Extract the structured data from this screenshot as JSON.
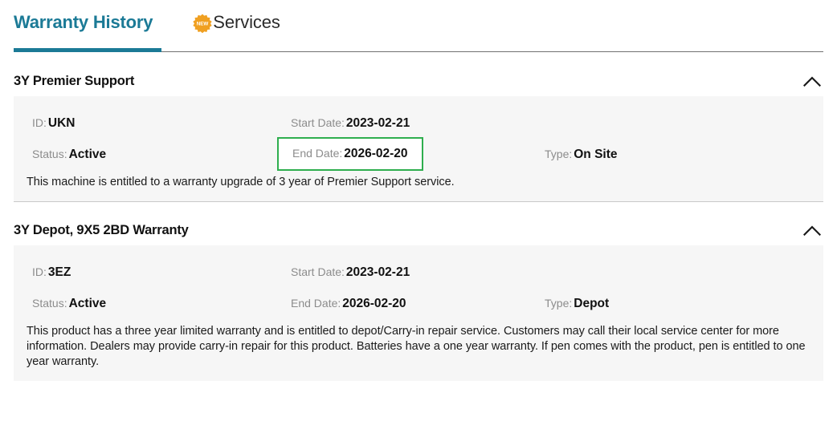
{
  "tabs": [
    {
      "id": "warranty-history",
      "label": "Warranty History",
      "active": true,
      "badge": null
    },
    {
      "id": "services",
      "label": "Services",
      "active": false,
      "badge": "NEW"
    }
  ],
  "colors": {
    "accent_teal": "#1b7a96",
    "badge_orange": "#f0a021",
    "highlight_green": "#2eae4e",
    "panel_bg": "#f6f6f6",
    "label_gray": "#8c8c8c"
  },
  "sections": [
    {
      "title": "3Y Premier Support",
      "expanded": true,
      "toggle_icon": "chevron-up-icon",
      "fields": {
        "id_label": "ID:",
        "id_value": "UKN",
        "start_date_label": "Start Date:",
        "start_date_value": "2023-02-21",
        "status_label": "Status:",
        "status_value": "Active",
        "end_date_label": "End Date:",
        "end_date_value": "2026-02-20",
        "type_label": "Type:",
        "type_value": "On Site"
      },
      "highlighted_field": "end_date",
      "description": "This machine is entitled to a warranty upgrade of 3 year of Premier Support service."
    },
    {
      "title": "3Y Depot, 9X5 2BD Warranty",
      "expanded": true,
      "toggle_icon": "chevron-up-icon",
      "fields": {
        "id_label": "ID:",
        "id_value": "3EZ",
        "start_date_label": "Start Date:",
        "start_date_value": "2023-02-21",
        "status_label": "Status:",
        "status_value": "Active",
        "end_date_label": "End Date:",
        "end_date_value": "2026-02-20",
        "type_label": "Type:",
        "type_value": "Depot"
      },
      "highlighted_field": null,
      "description": "This product has a three year limited warranty and is entitled to depot/Carry-in repair service. Customers may call their local service center for more information. Dealers may provide carry-in repair for this product. Batteries have a one year warranty. If pen comes with the product, pen is entitled to one year warranty."
    }
  ]
}
